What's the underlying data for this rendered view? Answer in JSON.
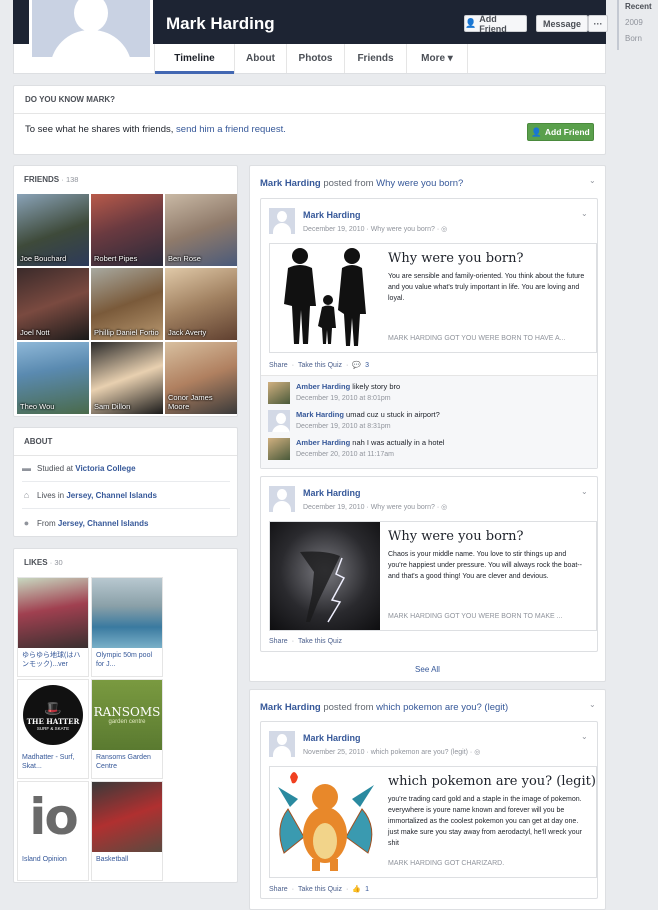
{
  "profile": {
    "name": "Mark Harding",
    "add_friend_label": "Add Friend",
    "message_label": "Message",
    "more_dots": "···"
  },
  "nav": {
    "tabs": [
      {
        "label": "Timeline"
      },
      {
        "label": "About"
      },
      {
        "label": "Photos"
      },
      {
        "label": "Friends"
      },
      {
        "label": "More ▾"
      }
    ]
  },
  "year_nav": [
    "Recent",
    "2009",
    "Born"
  ],
  "know": {
    "title": "DO YOU KNOW MARK?",
    "text_prefix": "To see what he shares with friends, ",
    "text_link": "send him a friend request.",
    "button_label": "Add Friend"
  },
  "friends": {
    "title": "FRIENDS",
    "count": "· 138",
    "items": [
      {
        "name": "Joe Bouchard"
      },
      {
        "name": "Robert Pipes"
      },
      {
        "name": "Ben Rose"
      },
      {
        "name": "Joel Nott"
      },
      {
        "name": "Phillip Daniel Fortio"
      },
      {
        "name": "Jack Averty"
      },
      {
        "name": "Theo Wou"
      },
      {
        "name": "Sam Dillon"
      },
      {
        "name": "Conor James Moore"
      }
    ]
  },
  "about": {
    "title": "ABOUT",
    "rows": [
      {
        "prefix": "Studied at ",
        "value": "Victoria College"
      },
      {
        "prefix": "Lives in ",
        "value": "Jersey, Channel Islands"
      },
      {
        "prefix": "From ",
        "value": "Jersey, Channel Islands"
      }
    ]
  },
  "likes": {
    "title": "LIKES",
    "count": "· 30",
    "items": [
      {
        "name": "ゆらゆら地球(はハンモック)...ver"
      },
      {
        "name": "Olympic 50m pool for J..."
      },
      {
        "name": "Madhatter - Surf, Skat..."
      },
      {
        "name": "Ransoms Garden Centre"
      },
      {
        "name": "Island Opinion"
      },
      {
        "name": "Basketball"
      }
    ],
    "logo_text": {
      "hatter_big": "THE HATTER",
      "hatter_small": "SURF & SKATE",
      "ransoms": "RANSOMS",
      "ransoms_sub": "garden centre",
      "io": "io"
    }
  },
  "story1": {
    "author": "Mark Harding",
    "verb": " posted from ",
    "source": "Why were you born?",
    "posts": [
      {
        "author": "Mark Harding",
        "meta": "December 19, 2010 · Why were you born? · ◎",
        "quiz_title": "Why were you born?",
        "quiz_desc": "You are sensible and family-oriented. You think about the future and you value what's truly important in life. You are loving and loyal.",
        "quiz_foot": "MARK HARDING GOT YOU WERE BORN TO HAVE A...",
        "share": "Share",
        "take": "Take this Quiz",
        "comment_count": "3",
        "comments": [
          {
            "author": "Amber Harding",
            "text": " likely story bro",
            "date": "December 19, 2010 at 8:01pm"
          },
          {
            "author": "Mark Harding",
            "text": " umad cuz u stuck in airport?",
            "date": "December 19, 2010 at 8:31pm"
          },
          {
            "author": "Amber Harding",
            "text": " nah I was actually in a hotel",
            "date": "December 20, 2010 at 11:17am"
          }
        ]
      },
      {
        "author": "Mark Harding",
        "meta": "December 19, 2010 · Why were you born? · ◎",
        "quiz_title": "Why were you born?",
        "quiz_desc": "Chaos is your middle name. You love to stir things up and you're happiest under pressure. You will always rock the boat-- and that's a good thing! You are clever and devious.",
        "quiz_foot": "MARK HARDING GOT YOU WERE BORN TO MAKE ...",
        "share": "Share",
        "take": "Take this Quiz"
      }
    ],
    "see_all": "See All"
  },
  "story2": {
    "author": "Mark Harding",
    "verb": " posted from ",
    "source": "which pokemon are you? (legit)",
    "post": {
      "author": "Mark Harding",
      "meta": "November 25, 2010 · which pokemon are you? (legit) · ◎",
      "quiz_title": "which pokemon are you? (legit)",
      "quiz_desc": "you're trading card gold and a staple in the image of pokemon. everywhere is youre name known and forever will you be immortalized as the coolest pokemon you can get at day one. just make sure you stay away from aerodactyl, he'll wreck your shit",
      "quiz_foot": "MARK HARDING GOT CHARIZARD.",
      "share": "Share",
      "take": "Take this Quiz",
      "like_count": "1"
    }
  },
  "colors": {
    "cover": "#1d2433",
    "link": "#365899",
    "add_friend_green": "#5aa04c",
    "page_bg": "#e9ebee"
  }
}
